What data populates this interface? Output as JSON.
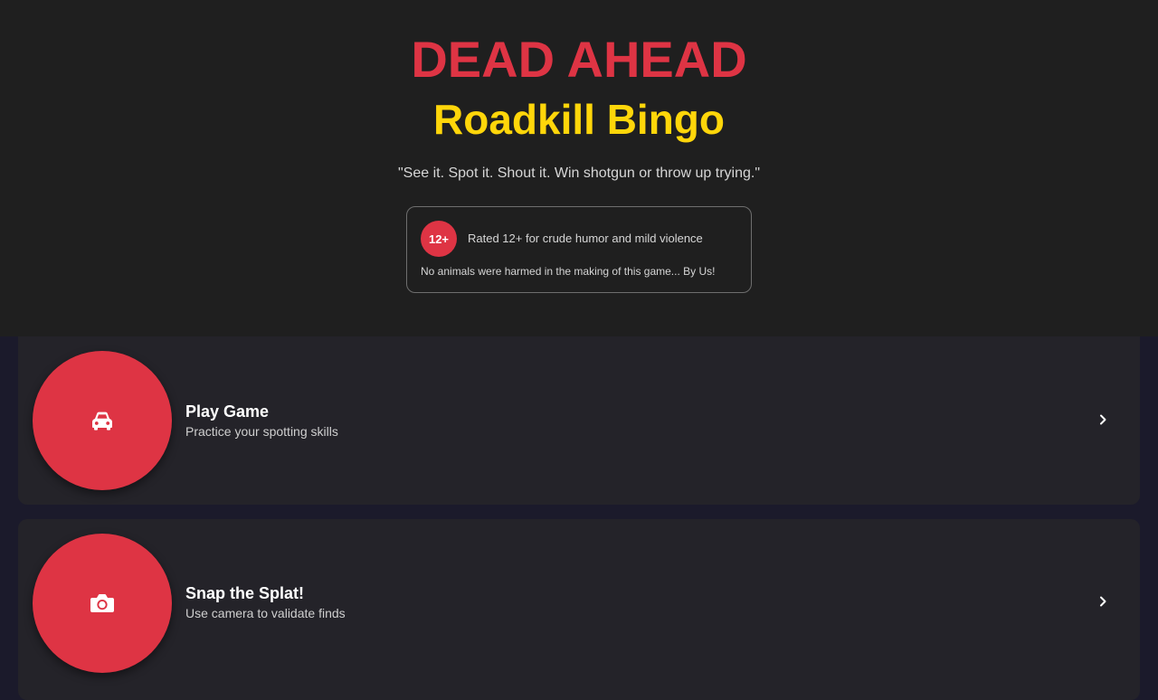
{
  "header": {
    "title": "DEAD AHEAD",
    "subtitle": "Roadkill Bingo",
    "tagline": "\"See it. Spot it. Shout it. Win shotgun or throw up trying.\"",
    "rating": {
      "badge": "12+",
      "text": "Rated 12+ for crude humor and mild violence",
      "note": "No animals were harmed in the making of this game... By Us!"
    }
  },
  "menu": {
    "items": [
      {
        "title": "Play Game",
        "description": "Practice your spotting skills",
        "icon": "car-icon"
      },
      {
        "title": "Snap the Splat!",
        "description": "Use camera to validate finds",
        "icon": "camera-icon"
      }
    ]
  },
  "colors": {
    "accent_red": "#de3444",
    "accent_yellow": "#ffd60a",
    "header_bg": "#1f1f1f",
    "card_bg": "#242329",
    "page_bg": "#1b1a2b"
  }
}
